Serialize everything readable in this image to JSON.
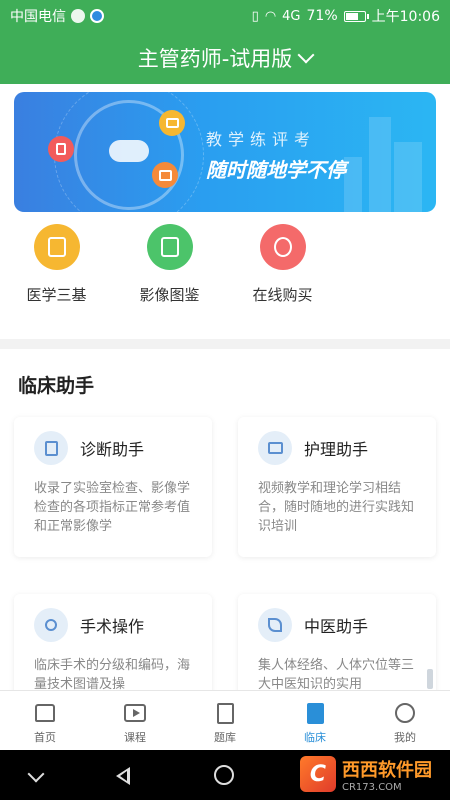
{
  "status": {
    "carrier": "中国电信",
    "signal_text": "4G",
    "battery": "71%",
    "battery_level": 0.71,
    "time": "上午10:06"
  },
  "header": {
    "title": "主管药师-试用版"
  },
  "banner": {
    "line1": "教学练评考",
    "line2": "随时随地学不停"
  },
  "quick_links": [
    {
      "label": "医学三基",
      "icon": "books-icon",
      "color": "#f6b731"
    },
    {
      "label": "影像图鉴",
      "icon": "album-icon",
      "color": "#4cc46a"
    },
    {
      "label": "在线购买",
      "icon": "money-bag-icon",
      "color": "#f46a6a"
    }
  ],
  "assistant": {
    "title": "临床助手",
    "cards": [
      {
        "title": "诊断助手",
        "desc": "收录了实验室检查、影像学检查的各项指标正常参考值和正常影像学",
        "icon": "clipboard-icon"
      },
      {
        "title": "护理助手",
        "desc": "视频教学和理论学习相结合，随时随地的进行实践知识培训",
        "icon": "video-icon"
      },
      {
        "title": "手术操作",
        "desc": "临床手术的分级和编码，海量技术图谱及操",
        "icon": "scissors-icon"
      },
      {
        "title": "中医助手",
        "desc": "集人体经络、人体穴位等三大中医知识的实用",
        "icon": "leaf-icon"
      }
    ]
  },
  "tabs": [
    {
      "label": "首页",
      "icon": "home-icon",
      "active": false
    },
    {
      "label": "课程",
      "icon": "course-play-icon",
      "active": false
    },
    {
      "label": "题库",
      "icon": "question-bank-icon",
      "active": false
    },
    {
      "label": "临床",
      "icon": "clinical-icon",
      "active": true
    },
    {
      "label": "我的",
      "icon": "profile-icon",
      "active": false
    }
  ],
  "watermark": {
    "logo": "C",
    "name": "西西软件园",
    "site": "CR173.COM"
  },
  "colors": {
    "primary": "#3fae58",
    "tab_active": "#2a8fd8"
  }
}
